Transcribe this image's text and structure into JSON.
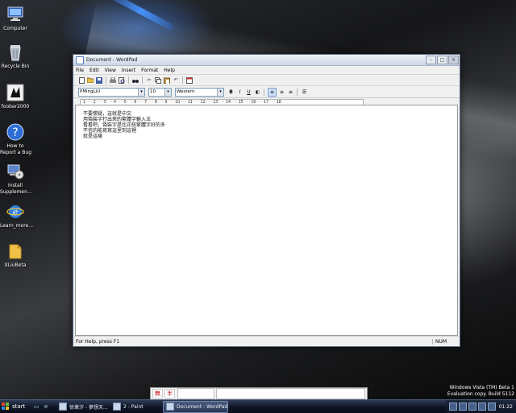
{
  "desktop": {
    "icons": [
      {
        "label_lines": [
          "Computer"
        ],
        "icon": "computer-icon"
      },
      {
        "label_lines": [
          "Recycle Bin"
        ],
        "icon": "recycle-bin-icon"
      },
      {
        "label_lines": [
          "foobar2000"
        ],
        "icon": "foobar2000-icon"
      },
      {
        "label_lines": [
          "How to",
          "Report a Bug"
        ],
        "icon": "help-icon"
      },
      {
        "label_lines": [
          "Install",
          "Supplemen..."
        ],
        "icon": "installer-icon"
      },
      {
        "label_lines": [
          "Learn_more..."
        ],
        "icon": "internet-explorer-icon"
      },
      {
        "label_lines": [
          "XLiuBeta"
        ],
        "icon": "folder-icon"
      }
    ]
  },
  "window": {
    "title": "Document - WordPad",
    "controls": [
      "minimize",
      "maximize",
      "close"
    ],
    "menu": [
      "File",
      "Edit",
      "View",
      "Insert",
      "Format",
      "Help"
    ],
    "toolbar_icons": [
      "new-icon",
      "open-icon",
      "save-icon",
      "print-icon",
      "print-preview-icon",
      "find-icon",
      "cut-icon",
      "copy-icon",
      "paste-icon",
      "undo-icon",
      "insert-date-icon"
    ],
    "format": {
      "font": "PMingLiU",
      "size": "10",
      "script": "Western",
      "buttons": [
        {
          "label": "B",
          "name": "bold-button"
        },
        {
          "label": "I",
          "name": "italic-button"
        },
        {
          "label": "U",
          "name": "underline-button"
        },
        {
          "label": "◐",
          "name": "color-button"
        },
        {
          "label": "≡",
          "name": "align-left-button"
        },
        {
          "label": "≡",
          "name": "align-center-button"
        },
        {
          "label": "≡",
          "name": "align-right-button"
        },
        {
          "label": "☰",
          "name": "bullets-button"
        }
      ]
    },
    "ruler": "· 1 · · · 2 · · · 3 · · · 4 · · · 5 · · · 6 · · · 7 · · · 8 · · · 9 · · · 10 · · · 11 · · · 12 · · · 13 · · · 14 · · · 15 · · · 16 · · · 17 · · · 18",
    "document_lines": [
      "不要懷疑，這就是中文",
      "用偽裝字打出來的繁體字輸入法",
      "看看吧，偽裝字是比正統繁體字好的多",
      "不信的能寫寫這里到這裡",
      "就是這樣"
    ],
    "status_help": "For Help, press F1",
    "status_num": "NUM"
  },
  "ime": {
    "button1": "無",
    "button2": "半"
  },
  "vista_watermark": {
    "line1": "Windows Vista (TM) Beta 1",
    "line2": "Evaluation copy. Build 5112"
  },
  "taskbar": {
    "start_label": "start",
    "quick_launch": [
      "show-desktop-icon",
      "ie-icon"
    ],
    "tasks": [
      {
        "label": "徐萧汐 - 夢想天...",
        "active": false
      },
      {
        "label": "2 - Paint",
        "active": false
      },
      {
        "label": "Document - WordPad",
        "active": true
      }
    ],
    "clock": "01:22",
    "colors": {
      "accent": "#2d3b55"
    }
  }
}
